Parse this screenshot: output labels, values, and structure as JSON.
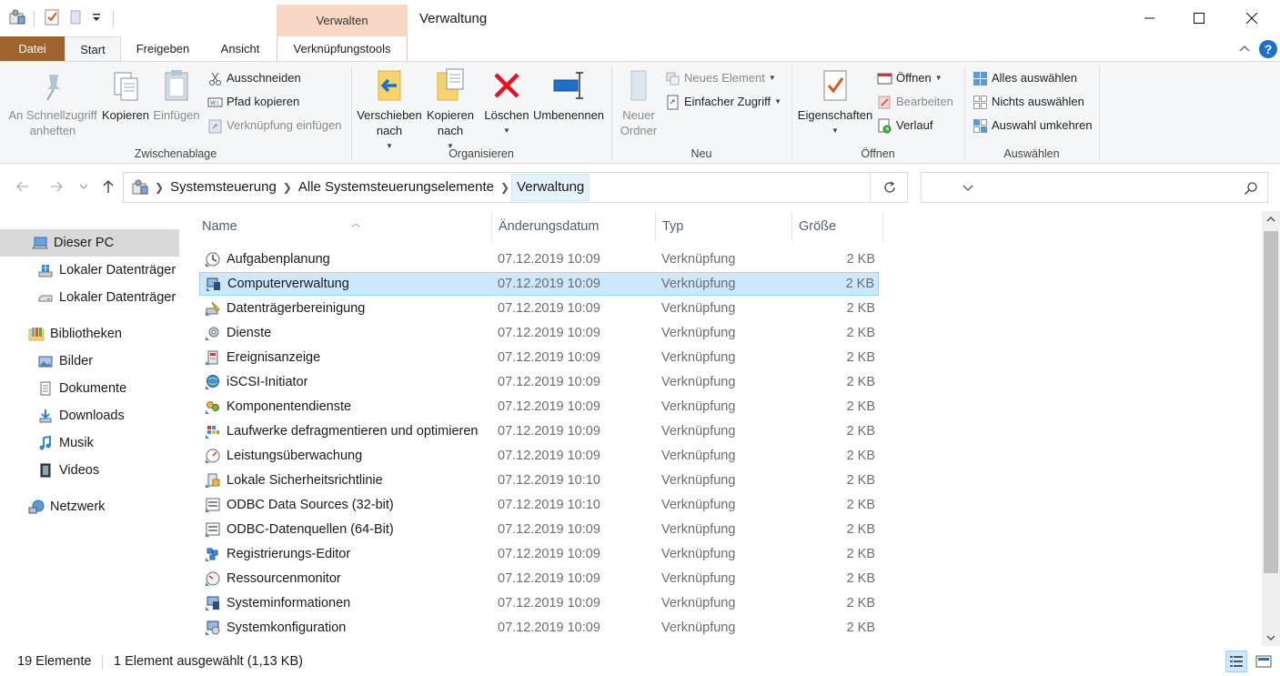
{
  "window": {
    "title": "Verwaltung",
    "context_header": "Verwalten"
  },
  "tabs": {
    "datei": "Datei",
    "start": "Start",
    "freigeben": "Freigeben",
    "ansicht": "Ansicht",
    "tools": "Verknüpfungstools"
  },
  "ribbon": {
    "clipboard": {
      "label": "Zwischenablage",
      "pin_line1": "An Schnellzugriff",
      "pin_line2": "anheften",
      "copy": "Kopieren",
      "paste": "Einfügen",
      "cut": "Ausschneiden",
      "copy_path": "Pfad kopieren",
      "paste_shortcut": "Verknüpfung einfügen"
    },
    "organize": {
      "label": "Organisieren",
      "move_line1": "Verschieben",
      "move_line2": "nach",
      "copyto_line1": "Kopieren",
      "copyto_line2": "nach",
      "delete": "Löschen",
      "rename": "Umbenennen"
    },
    "new": {
      "label": "Neu",
      "folder_line1": "Neuer",
      "folder_line2": "Ordner",
      "new_item": "Neues Element",
      "easy_access": "Einfacher Zugriff"
    },
    "open": {
      "label": "Öffnen",
      "properties": "Eigenschaften",
      "open": "Öffnen",
      "edit": "Bearbeiten",
      "history": "Verlauf"
    },
    "select": {
      "label": "Auswählen",
      "select_all": "Alles auswählen",
      "select_none": "Nichts auswählen",
      "invert": "Auswahl umkehren"
    }
  },
  "address": {
    "crumbs": [
      "Systemsteuerung",
      "Alle Systemsteuerungselemente",
      "Verwaltung"
    ]
  },
  "navpane": {
    "items": [
      {
        "label": "Dieser PC",
        "icon": "pc-icon",
        "selected": true
      },
      {
        "label": "Lokaler Datenträger (C:)",
        "icon": "windows-drive-icon"
      },
      {
        "label": "Lokaler Datenträger (D:)",
        "icon": "drive-icon"
      },
      {
        "label": "Bibliotheken",
        "icon": "libraries-icon"
      },
      {
        "label": "Bilder",
        "icon": "pictures-icon"
      },
      {
        "label": "Dokumente",
        "icon": "documents-icon"
      },
      {
        "label": "Downloads",
        "icon": "downloads-icon"
      },
      {
        "label": "Musik",
        "icon": "music-icon"
      },
      {
        "label": "Videos",
        "icon": "videos-icon"
      },
      {
        "label": "Netzwerk",
        "icon": "network-icon"
      }
    ]
  },
  "columns": {
    "name": "Name",
    "date": "Änderungsdatum",
    "type": "Typ",
    "size": "Größe"
  },
  "files": [
    {
      "name": "Aufgabenplanung",
      "date": "07.12.2019 10:09",
      "type": "Verknüpfung",
      "size": "2 KB"
    },
    {
      "name": "Computerverwaltung",
      "date": "07.12.2019 10:09",
      "type": "Verknüpfung",
      "size": "2 KB",
      "selected": true
    },
    {
      "name": "Datenträgerbereinigung",
      "date": "07.12.2019 10:09",
      "type": "Verknüpfung",
      "size": "2 KB"
    },
    {
      "name": "Dienste",
      "date": "07.12.2019 10:09",
      "type": "Verknüpfung",
      "size": "2 KB"
    },
    {
      "name": "Ereignisanzeige",
      "date": "07.12.2019 10:09",
      "type": "Verknüpfung",
      "size": "2 KB"
    },
    {
      "name": "iSCSI-Initiator",
      "date": "07.12.2019 10:09",
      "type": "Verknüpfung",
      "size": "2 KB"
    },
    {
      "name": "Komponentendienste",
      "date": "07.12.2019 10:09",
      "type": "Verknüpfung",
      "size": "2 KB"
    },
    {
      "name": "Laufwerke defragmentieren und optimieren",
      "date": "07.12.2019 10:09",
      "type": "Verknüpfung",
      "size": "2 KB"
    },
    {
      "name": "Leistungsüberwachung",
      "date": "07.12.2019 10:09",
      "type": "Verknüpfung",
      "size": "2 KB"
    },
    {
      "name": "Lokale Sicherheitsrichtlinie",
      "date": "07.12.2019 10:10",
      "type": "Verknüpfung",
      "size": "2 KB"
    },
    {
      "name": "ODBC Data Sources (32-bit)",
      "date": "07.12.2019 10:10",
      "type": "Verknüpfung",
      "size": "2 KB"
    },
    {
      "name": "ODBC-Datenquellen (64-Bit)",
      "date": "07.12.2019 10:09",
      "type": "Verknüpfung",
      "size": "2 KB"
    },
    {
      "name": "Registrierungs-Editor",
      "date": "07.12.2019 10:09",
      "type": "Verknüpfung",
      "size": "2 KB"
    },
    {
      "name": "Ressourcenmonitor",
      "date": "07.12.2019 10:09",
      "type": "Verknüpfung",
      "size": "2 KB"
    },
    {
      "name": "Systeminformationen",
      "date": "07.12.2019 10:09",
      "type": "Verknüpfung",
      "size": "2 KB"
    },
    {
      "name": "Systemkonfiguration",
      "date": "07.12.2019 10:09",
      "type": "Verknüpfung",
      "size": "2 KB"
    }
  ],
  "status": {
    "count": "19 Elemente",
    "selection": "1 Element ausgewählt (1,13 KB)"
  },
  "colors": {
    "datei_tab": "#a0632e",
    "context_header": "#f8d7c4",
    "selection": "#cce8ff",
    "selection_border": "#99d1ff",
    "delete_red": "#e81123",
    "folder_yellow": "#f7d46b",
    "accent_blue": "#1d6fc7"
  }
}
